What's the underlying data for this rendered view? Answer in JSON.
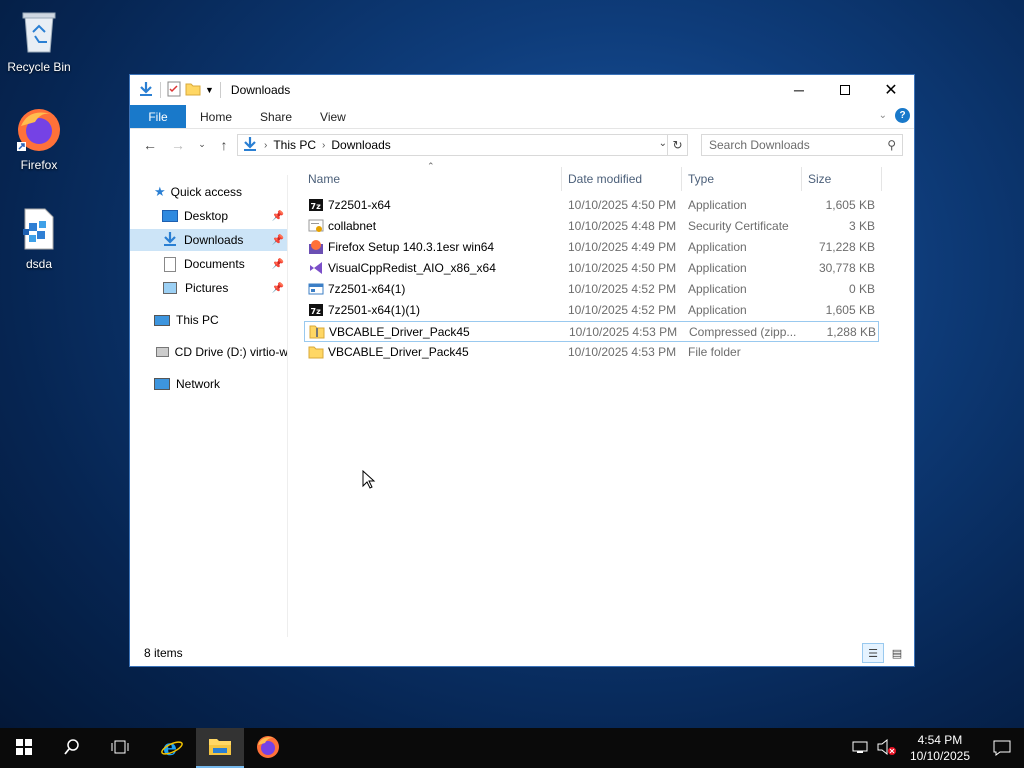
{
  "desktop": {
    "icons": [
      {
        "label": "Recycle Bin",
        "icon": "recycle-bin-icon"
      },
      {
        "label": "Firefox",
        "icon": "firefox-icon"
      },
      {
        "label": "dsda",
        "icon": "registry-file-icon"
      }
    ]
  },
  "window": {
    "title": "Downloads",
    "ribbon_tabs": [
      "File",
      "Home",
      "Share",
      "View"
    ],
    "breadcrumb": [
      "This PC",
      "Downloads"
    ],
    "search_placeholder": "Search Downloads",
    "colors": {
      "accent": "#1979ca",
      "selection": "#cce4f7",
      "header_text": "#4c607a"
    }
  },
  "navpane": {
    "items": [
      {
        "label": "Quick access",
        "icon": "star-icon",
        "pinned": false
      },
      {
        "label": "Desktop",
        "icon": "desktop-icon",
        "pinned": true
      },
      {
        "label": "Downloads",
        "icon": "download-arrow-icon",
        "pinned": true,
        "selected": true
      },
      {
        "label": "Documents",
        "icon": "document-icon",
        "pinned": true
      },
      {
        "label": "Pictures",
        "icon": "picture-icon",
        "pinned": true
      },
      {
        "label": "This PC",
        "icon": "computer-icon",
        "pinned": false
      },
      {
        "label": "CD Drive (D:) virtio-w",
        "icon": "cd-drive-icon",
        "pinned": false
      },
      {
        "label": "Network",
        "icon": "network-icon",
        "pinned": false
      }
    ]
  },
  "filelist": {
    "columns": [
      "Name",
      "Date modified",
      "Type",
      "Size"
    ],
    "rows": [
      {
        "name": "7z2501-x64",
        "date": "10/10/2025 4:50 PM",
        "type": "Application",
        "size": "1,605 KB",
        "icon": "7zip-icon"
      },
      {
        "name": "collabnet",
        "date": "10/10/2025 4:48 PM",
        "type": "Security Certificate",
        "size": "3 KB",
        "icon": "certificate-icon"
      },
      {
        "name": "Firefox Setup 140.3.1esr win64",
        "date": "10/10/2025 4:49 PM",
        "type": "Application",
        "size": "71,228 KB",
        "icon": "firefox-installer-icon"
      },
      {
        "name": "VisualCppRedist_AIO_x86_x64",
        "date": "10/10/2025 4:50 PM",
        "type": "Application",
        "size": "30,778 KB",
        "icon": "visual-studio-icon"
      },
      {
        "name": "7z2501-x64(1)",
        "date": "10/10/2025 4:52 PM",
        "type": "Application",
        "size": "0 KB",
        "icon": "application-icon"
      },
      {
        "name": "7z2501-x64(1)(1)",
        "date": "10/10/2025 4:52 PM",
        "type": "Application",
        "size": "1,605 KB",
        "icon": "7zip-icon"
      },
      {
        "name": "VBCABLE_Driver_Pack45",
        "date": "10/10/2025 4:53 PM",
        "type": "Compressed (zipp...",
        "size": "1,288 KB",
        "icon": "zip-folder-icon"
      },
      {
        "name": "VBCABLE_Driver_Pack45",
        "date": "10/10/2025 4:53 PM",
        "type": "File folder",
        "size": "",
        "icon": "folder-icon"
      }
    ]
  },
  "status": {
    "item_count": "8 items"
  },
  "taskbar": {
    "time": "4:54 PM",
    "date": "10/10/2025"
  }
}
